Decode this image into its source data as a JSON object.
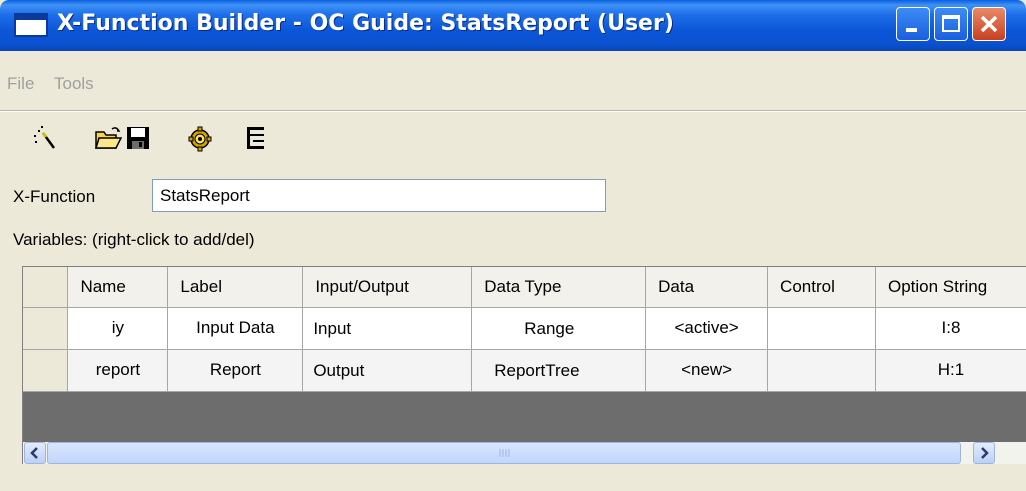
{
  "window": {
    "title": "X-Function Builder - OC Guide: StatsReport (User)"
  },
  "menu": {
    "items": [
      "File",
      "Tools"
    ]
  },
  "toolbar": {
    "icons": [
      "wand-icon",
      "open-folder-icon",
      "save-icon",
      "compile-gear-icon",
      "tree-view-icon"
    ]
  },
  "form": {
    "xfunction_label": "X-Function",
    "xfunction_value": "StatsReport",
    "variables_label": "Variables: (right-click to add/del)"
  },
  "grid": {
    "columns": [
      "Name",
      "Label",
      "Input/Output",
      "Data Type",
      "Data",
      "Control",
      "Option String"
    ],
    "rows": [
      {
        "name": "iy",
        "label": "Input Data",
        "io": "Input",
        "data_type": "Range",
        "data": "<active>",
        "control": "",
        "option": "I:8"
      },
      {
        "name": "report",
        "label": "Report",
        "io": "Output",
        "data_type": "ReportTree",
        "data": "<new>",
        "control": "",
        "option": "H:1"
      }
    ]
  },
  "colors": {
    "titlebar": "#0a52d0",
    "window_bg": "#ece9d8",
    "close_button": "#c9401f"
  }
}
